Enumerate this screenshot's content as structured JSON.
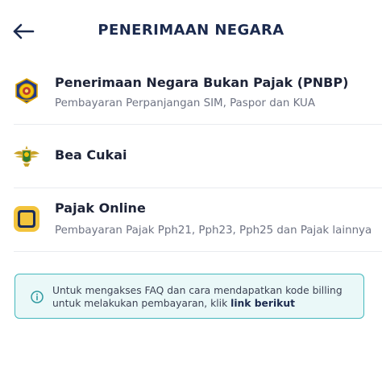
{
  "header": {
    "title": "PENERIMAAN NEGARA",
    "back_icon": "arrow-left-icon"
  },
  "items": [
    {
      "name": "Penerimaan Negara Bukan Pajak (PNBP)",
      "description": "Pembayaran Perpanjangan SIM, Paspor dan KUA",
      "icon": "kemenkeu-emblem-icon"
    },
    {
      "name": "Bea Cukai",
      "description": "",
      "icon": "bea-cukai-emblem-icon"
    },
    {
      "name": "Pajak Online",
      "description": "Pembayaran Pajak Pph21, Pph23, Pph25 dan Pajak lainnya",
      "icon": "pajak-online-app-icon"
    }
  ],
  "info": {
    "icon": "info-circle-icon",
    "text_prefix": "Untuk mengakses FAQ dan cara mendapatkan kode billing untuk melakukan pembayaran, klik ",
    "link_text": "link berikut"
  },
  "colors": {
    "title": "#1b2a4e",
    "info_border": "#44b8bd",
    "info_background": "#eaf8f8",
    "pajak_icon_yellow": "#f3c43c",
    "pajak_icon_navy": "#1c2c5a"
  }
}
